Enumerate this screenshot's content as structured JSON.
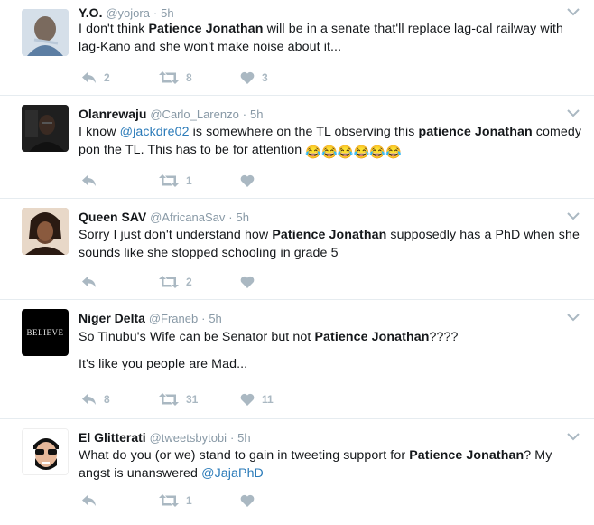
{
  "tweets": [
    {
      "name": "Y.O.",
      "handle": "@yojora",
      "time": "5h",
      "avatar_color": "#9bb0c8",
      "segments": [
        "I don't think ",
        "Patience Jonathan",
        " will be in a senate that'll replace lag-cal railway with lag-Kano and she won't make noise about it..."
      ],
      "replies": "2",
      "retweets": "8",
      "likes": "3"
    },
    {
      "name": "Olanrewaju",
      "handle": "@Carlo_Larenzo",
      "time": "5h",
      "avatar_color": "#2a2a2a",
      "segments": [
        "I know ",
        "@jackdre02",
        " is somewhere on the TL observing this ",
        "patience Jonathan",
        " comedy pon the TL. This has to be for attention "
      ],
      "emoji": "😂😂😂😂😂😂",
      "replies": "",
      "retweets": "1",
      "likes": ""
    },
    {
      "name": "Queen SAV",
      "handle": "@AfricanaSav",
      "time": "5h",
      "avatar_color": "#5a3a2a",
      "segments": [
        "Sorry I just don't understand how ",
        "Patience Jonathan",
        " supposedly has a PhD when she sounds like she stopped schooling in grade 5"
      ],
      "replies": "",
      "retweets": "2",
      "likes": ""
    },
    {
      "name": "Niger Delta",
      "handle": "@Franeb",
      "time": "5h",
      "avatar_text": "BELIEVE",
      "avatar_color": "#000000",
      "line1": [
        "So Tinubu's Wife can be Senator but not ",
        "Patience Jonathan",
        "????"
      ],
      "line2": "It's like you people are Mad...",
      "replies": "8",
      "retweets": "31",
      "likes": "11"
    },
    {
      "name": "El Glitterati",
      "handle": "@tweetsbytobi",
      "time": "5h",
      "avatar_color": "#ffffff",
      "segments": [
        "What do you (or we) stand to gain in tweeting support for ",
        "Patience Jonathan",
        "? My angst is unanswered ",
        "@JajaPhD"
      ],
      "replies": "",
      "retweets": "1",
      "likes": ""
    }
  ],
  "colors": {
    "accent": "#2b7bb9",
    "muted": "#8899a6",
    "icon": "#aab8c2",
    "divider": "#e6ecf0"
  }
}
